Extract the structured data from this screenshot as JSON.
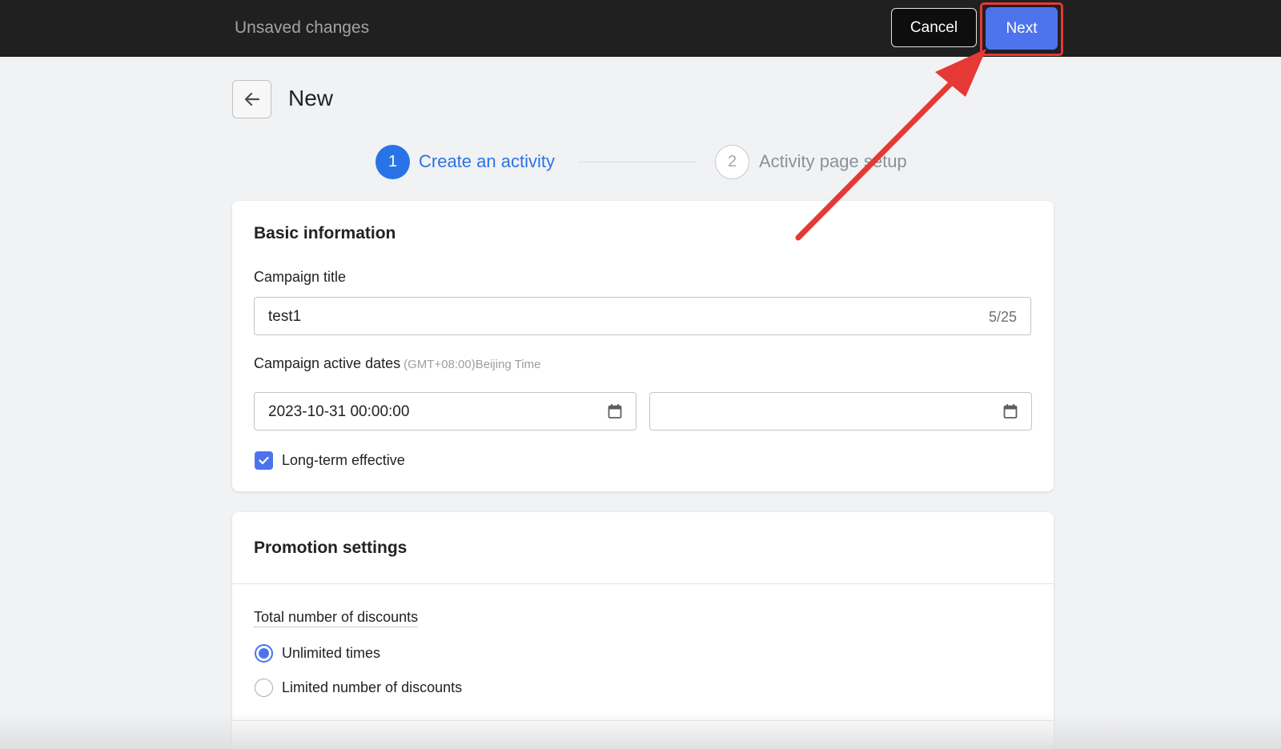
{
  "topbar": {
    "status_text": "Unsaved changes",
    "cancel_label": "Cancel",
    "next_label": "Next"
  },
  "header": {
    "back_icon": "arrow-left-icon",
    "title": "New"
  },
  "steps": [
    {
      "number": "1",
      "label": "Create an activity",
      "active": true
    },
    {
      "number": "2",
      "label": "Activity page setup",
      "active": false
    }
  ],
  "basic_info": {
    "section_title": "Basic information",
    "campaign_title_label": "Campaign title",
    "campaign_title_value": "test1",
    "campaign_title_counter": "5/25",
    "dates_label": "Campaign active dates",
    "dates_hint": "(GMT+08:00)Beijing Time",
    "start_date_value": "2023-10-31 00:00:00",
    "end_date_value": "",
    "calendar_icon": "calendar-icon",
    "long_term_label": "Long-term effective",
    "long_term_checked": true
  },
  "promotion": {
    "section_title": "Promotion settings",
    "total_discounts_label": "Total number of discounts",
    "options": [
      {
        "label": "Unlimited times",
        "selected": true
      },
      {
        "label": "Limited number of discounts",
        "selected": false
      }
    ]
  },
  "annotation": {
    "color": "#e53935"
  },
  "colors": {
    "accent": "#4d73ec",
    "step_active": "#2a73e6",
    "topbar": "#202020"
  }
}
